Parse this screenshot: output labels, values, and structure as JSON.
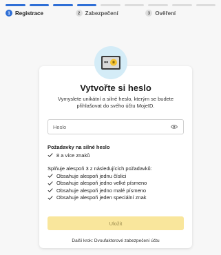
{
  "progress": {
    "segments_total": 9,
    "segments_active": 4
  },
  "steps": [
    {
      "number": "1",
      "label": "Registrace",
      "active": true
    },
    {
      "number": "2",
      "label": "Zabezpečení",
      "active": false
    },
    {
      "number": "3",
      "label": "Ověření",
      "active": false
    }
  ],
  "card": {
    "title": "Vytvořte si heslo",
    "description": "Vymyslete unikátní a silné heslo, kterým se budete přihlašovat do svého účtu MojeID.",
    "password_placeholder": "Heslo",
    "requirements_title": "Požadavky na silné heslo",
    "requirement_main": "8 a více znaků",
    "subrequirements_title": "Splňuje alespoň 3 z následujících požadavků:",
    "subrequirements": [
      "Obsahuje alespoň jednu číslici",
      "Obsahuje alespoň jedno velké písmeno",
      "Obsahuje alespoň jedno malé písmeno",
      "Obsahuje alespoň jeden speciální znak"
    ],
    "save_label": "Uložit",
    "next_step": "Další krok: Dvoufaktorové zabezpečení účtu"
  },
  "colors": {
    "accent": "#2f6fd6",
    "button_disabled": "#f9e69c",
    "icon_bg": "#d4ecf7"
  },
  "icons": {
    "hero": "password-device-icon",
    "eye": "eye-icon",
    "check": "check-icon"
  }
}
